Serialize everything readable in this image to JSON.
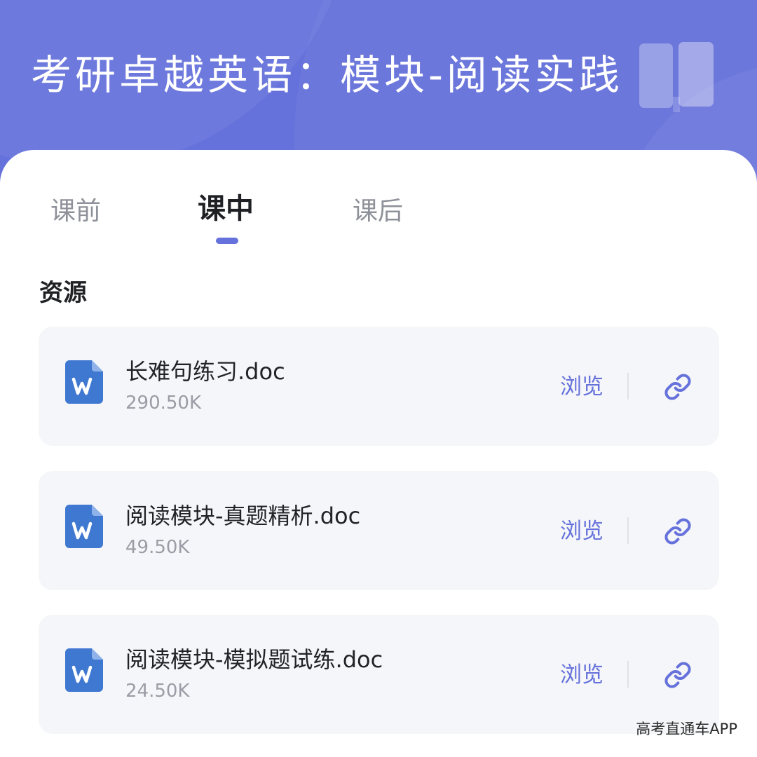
{
  "header": {
    "title": "考研卓越英语：模块-阅读实践",
    "icon": "book-icon",
    "background_color": "#6672db"
  },
  "tabs": [
    {
      "label": "课前",
      "active": false
    },
    {
      "label": "课中",
      "active": true
    },
    {
      "label": "课后",
      "active": false
    }
  ],
  "section": {
    "title": "资源"
  },
  "resources": [
    {
      "name": "长难句练习.doc",
      "size": "290.50K",
      "type_icon": "word-doc-icon",
      "browse_label": "浏览",
      "action_icon": "link-icon"
    },
    {
      "name": "阅读模块-真题精析.doc",
      "size": "49.50K",
      "type_icon": "word-doc-icon",
      "browse_label": "浏览",
      "action_icon": "link-icon"
    },
    {
      "name": "阅读模块-模拟题试练.doc",
      "size": "24.50K",
      "type_icon": "word-doc-icon",
      "browse_label": "浏览",
      "action_icon": "link-icon"
    }
  ],
  "colors": {
    "accent": "#6672db",
    "doc_icon": "#3f78d1",
    "card_background": "#f5f6f9"
  },
  "watermark": "高考直通车APP"
}
